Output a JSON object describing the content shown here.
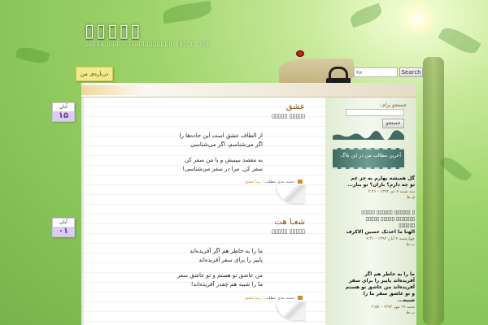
{
  "header": {
    "blog_title": "▯▯▯▯▯",
    "blog_description": "▯▯▯▯▯ ▯▯▯▯▯ ▯▯▯▯▯▯▯▯▯▯▯ ▯▯▯▯▯ ▯▯▯",
    "about_tab": "درباره‌ی من",
    "search_placeholder": "Ke",
    "search_button": "Search"
  },
  "posts": [
    {
      "date_month": "آبان",
      "date_day": "۱۵",
      "title": "عشق",
      "subtitle": "▯▯▯▯▯ ▯▯▯▯▯",
      "paragraphs": [
        "از الطاف عشق است این جاده‌ها را\nاگر می‌شناسم، اگر می‌شناسی",
        "به مقصد نبینیش و با من سفر کن\nسفر کن، مرا در سفر می‌شناسی!"
      ],
      "meta_label": "دسته بندی مطلب :",
      "meta_link": "زیبا عشق"
    },
    {
      "date_month": "آبان",
      "date_day": "۰۱",
      "title": "شعـا هت",
      "subtitle": "▯▯▯▯▯ ▯▯▯▯▯",
      "paragraphs": [
        "ما را به خاطر هم اگر آفریده‌اند\nپاییز را برای سفر آفریده‌اند",
        "من عاشق تو هستم و تو عاشق سفر\nما را شبیه هم چقدر آفریده‌اند!"
      ],
      "meta_label": "دسته بندی مطلب :",
      "meta_link": "زیبا عشق"
    }
  ],
  "sidebar": {
    "search_label": "جستجو برای:",
    "search_button": "جستجو",
    "recent_banner": "آخرین مطالب من در این بلاگ",
    "recent_posts": [
      {
        "title": "گل همیشه بهارم به جز غم\nتو چه دارم؟ باران؟ تو بنار...",
        "date": "سه شنبه ۷ دی ۱۳۹۲ - ۲:۲۶",
        "author": "ق.ط"
      },
      {
        "title": "▯ ▯▯▯▯▯▯ ▯▯▯▯▯▯ ▯▯▯▯▯\n▯▯▯▯▯▯▯ ▯▯▯▯▯ ▯▯▯▯▯\n▯▯▯▯▯▯\nالهنا ما اعذنک حسین الاکرف",
        "date": "چهارشنبه ۷ آبان ۱۳۹۲ - ۹:۳۱",
        "author": "ب.ط"
      },
      {
        "title": "ما را به خاطر هم اگر\nآفریده‌اند پاییز را برای سفر\nآفریده‌اند من عاشق تو هستم\nو تو عاشق سفر ما را\nشبیه...",
        "date": "شنبه ۱۹ مهر ۱۳۹۲ - ۲:۵۷",
        "author": "ب.ط"
      }
    ]
  },
  "colors": {
    "background": "#9fd46a",
    "accent_title": "#8b4a06",
    "date_tab": "#dbcdf1"
  }
}
